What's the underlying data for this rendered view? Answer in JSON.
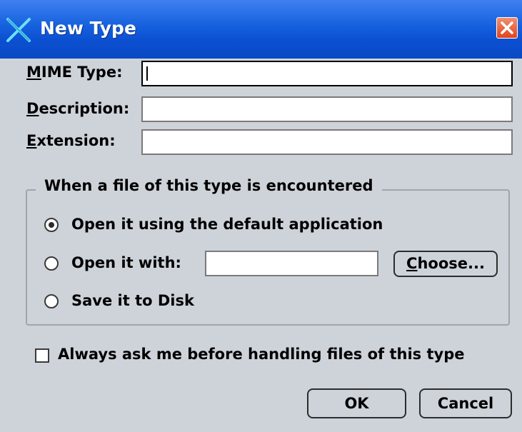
{
  "window": {
    "title": "New Type",
    "icon": "x-logo-icon",
    "close_icon": "close-icon"
  },
  "fields": {
    "mime_type": {
      "label_mnemonic": "M",
      "label_rest": "IME Type:",
      "value": ""
    },
    "description": {
      "label_mnemonic": "D",
      "label_rest": "escription:",
      "value": ""
    },
    "extension": {
      "label_mnemonic": "E",
      "label_rest": "xtension:",
      "value": ""
    }
  },
  "group": {
    "legend": "When a file of this type is encountered",
    "options": [
      {
        "label": "Open it using the default application",
        "selected": true
      },
      {
        "label": "Open it with:",
        "selected": false
      },
      {
        "label": "Save it to Disk",
        "selected": false
      }
    ],
    "app_path_value": "",
    "choose_mnemonic": "C",
    "choose_rest": "hoose..."
  },
  "always_ask": {
    "label": "Always ask me before handling files of this type",
    "checked": false
  },
  "buttons": {
    "ok": "OK",
    "cancel": "Cancel"
  },
  "colors": {
    "titlebar": "#1560de",
    "dialog_bg": "#ced3da",
    "close": "#e0441c"
  }
}
